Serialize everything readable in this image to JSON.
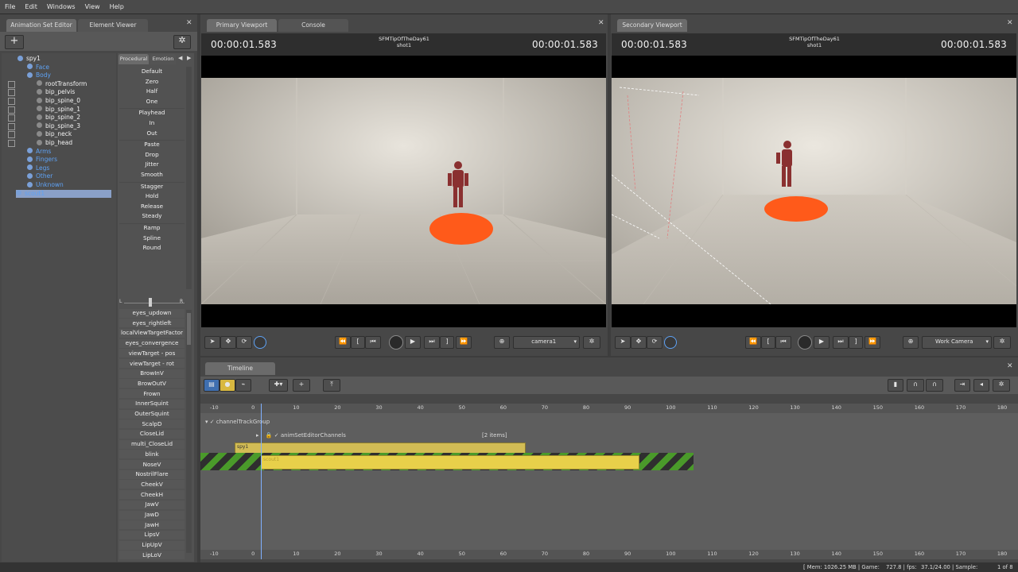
{
  "menu": [
    "File",
    "Edit",
    "Windows",
    "View",
    "Help"
  ],
  "left_panel": {
    "tabs": [
      "Animation Set Editor",
      "Element Viewer"
    ],
    "sub_tabs": [
      "Procedural",
      "Emotion"
    ],
    "tree": [
      {
        "label": "spy1",
        "color": "white",
        "indent": 0
      },
      {
        "label": "Face",
        "color": "blue",
        "indent": 1
      },
      {
        "label": "Body",
        "color": "blue",
        "indent": 1
      },
      {
        "label": "rootTransform",
        "color": "white",
        "indent": 2
      },
      {
        "label": "bip_pelvis",
        "color": "white",
        "indent": 2
      },
      {
        "label": "bip_spine_0",
        "color": "white",
        "indent": 2
      },
      {
        "label": "bip_spine_1",
        "color": "white",
        "indent": 2
      },
      {
        "label": "bip_spine_2",
        "color": "white",
        "indent": 2
      },
      {
        "label": "bip_spine_3",
        "color": "white",
        "indent": 2
      },
      {
        "label": "bip_neck",
        "color": "white",
        "indent": 2
      },
      {
        "label": "bip_head",
        "color": "white",
        "indent": 2
      },
      {
        "label": "Arms",
        "color": "blue",
        "indent": 1
      },
      {
        "label": "Fingers",
        "color": "blue",
        "indent": 1
      },
      {
        "label": "Legs",
        "color": "blue",
        "indent": 1
      },
      {
        "label": "Other",
        "color": "blue",
        "indent": 1
      },
      {
        "label": "Unknown",
        "color": "blue",
        "indent": 1
      },
      {
        "label": "scout1",
        "color": "blue",
        "indent": 0
      }
    ],
    "presets": [
      "Default",
      "Zero",
      "Half",
      "One",
      "Playhead",
      "In",
      "Out",
      "Paste",
      "Drop",
      "Jitter",
      "Smooth",
      "Stagger",
      "Hold",
      "Release",
      "Steady",
      "Ramp",
      "Spline",
      "Round"
    ],
    "slider_left": "L",
    "slider_right": "R",
    "controls": [
      "eyes_updown",
      "eyes_rightleft",
      "localViewTargetFactor",
      "eyes_convergence",
      "viewTarget - pos",
      "viewTarget - rot",
      "BrowInV",
      "BrowOutV",
      "Frown",
      "InnerSquint",
      "OuterSquint",
      "ScalpD",
      "CloseLid",
      "multi_CloseLid",
      "blink",
      "NoseV",
      "NostrilFlare",
      "CheekV",
      "CheekH",
      "JawV",
      "JawD",
      "JawH",
      "LipsV",
      "LipUpV",
      "LipLoV"
    ]
  },
  "primary_viewport": {
    "tabs": [
      "Primary Viewport",
      "Console"
    ],
    "time_left": "00:00:01.583",
    "time_right": "00:00:01.583",
    "session": "SFMTipOfTheDay61",
    "shot": "shot1",
    "camera": "camera1"
  },
  "secondary_viewport": {
    "tab": "Secondary Viewport",
    "time_left": "00:00:01.583",
    "time_right": "00:00:01.583",
    "session": "SFMTipOfTheDay61",
    "shot": "shot1",
    "camera": "Work Camera"
  },
  "timeline": {
    "tab": "Timeline",
    "ruler": [
      "-10",
      "0",
      "10",
      "20",
      "30",
      "40",
      "50",
      "60",
      "70",
      "80",
      "90",
      "100",
      "110",
      "120",
      "130",
      "140",
      "150",
      "160",
      "170",
      "180"
    ],
    "group": "channelTrackGroup",
    "channels": "animSetEditorChannels",
    "items_count": "[2 items]",
    "clip1": "spy1",
    "clip2": "scout1"
  },
  "status": {
    "mem": "[ Mem: 1026.25 MB | Game:",
    "game": "727.8 | fps:",
    "fps": "37.1/24.00 | Sample:",
    "sample": "1 of 8"
  },
  "colors": {
    "accent_blue": "#5ea2f5",
    "clip_yellow": "#e8d04a",
    "floor_orange": "#ff5a1a",
    "hazard_green": "#4a9a2a"
  }
}
